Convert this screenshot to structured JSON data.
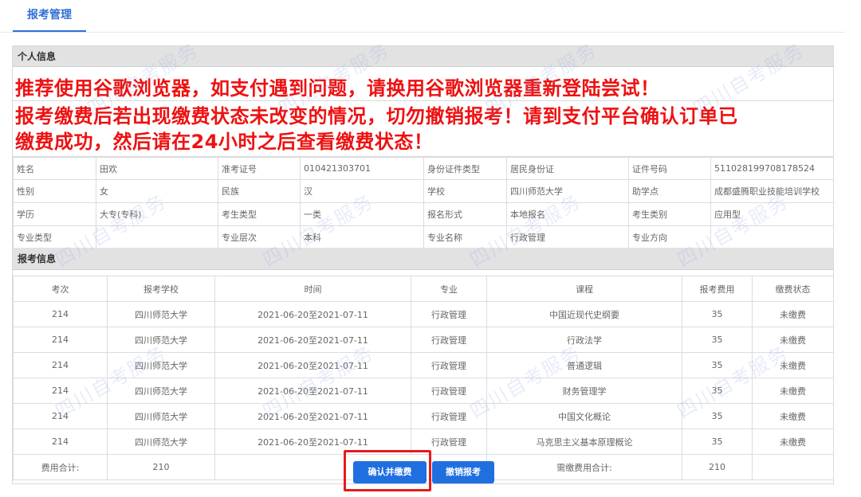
{
  "tab": {
    "label": "报考管理"
  },
  "personal_section": {
    "title": "个人信息"
  },
  "notice": {
    "line1": "推荐使用谷歌浏览器，如支付遇到问题，请换用谷歌浏览器重新登陆尝试！",
    "line2": "报考缴费后若出现缴费状态未改变的情况，切勿撤销报考！请到支付平台确认订单已",
    "line3": "缴费成功，然后请在24小时之后查看缴费状态！"
  },
  "info_rows": [
    [
      "姓名",
      "田欢",
      "准考证号",
      "010421303701",
      "身份证件类型",
      "居民身份证",
      "证件号码",
      "511028199708178524"
    ],
    [
      "性别",
      "女",
      "民族",
      "汉",
      "学校",
      "四川师范大学",
      "助学点",
      "成都盛腾职业技能培训学校"
    ],
    [
      "学历",
      "大专(专科)",
      "考生类型",
      "一类",
      "报名形式",
      "本地报名",
      "考生类别",
      "应用型"
    ],
    [
      "专业类型",
      "",
      "专业层次",
      "本科",
      "专业名称",
      "行政管理",
      "专业方向",
      ""
    ]
  ],
  "exam_section": {
    "title": "报考信息"
  },
  "exam_table": {
    "headers": [
      "考次",
      "报考学校",
      "时间",
      "专业",
      "课程",
      "报考费用",
      "缴费状态"
    ],
    "rows": [
      [
        "214",
        "四川师范大学",
        "2021-06-20至2021-07-11",
        "行政管理",
        "中国近现代史纲要",
        "35",
        "未缴费"
      ],
      [
        "214",
        "四川师范大学",
        "2021-06-20至2021-07-11",
        "行政管理",
        "行政法学",
        "35",
        "未缴费"
      ],
      [
        "214",
        "四川师范大学",
        "2021-06-20至2021-07-11",
        "行政管理",
        "普通逻辑",
        "35",
        "未缴费"
      ],
      [
        "214",
        "四川师范大学",
        "2021-06-20至2021-07-11",
        "行政管理",
        "财务管理学",
        "35",
        "未缴费"
      ],
      [
        "214",
        "四川师范大学",
        "2021-06-20至2021-07-11",
        "行政管理",
        "中国文化概论",
        "35",
        "未缴费"
      ],
      [
        "214",
        "四川师范大学",
        "2021-06-20至2021-07-11",
        "行政管理",
        "马克思主义基本原理概论",
        "35",
        "未缴费"
      ]
    ],
    "total": {
      "label": "费用合计:",
      "value": "210",
      "due_label": "需缴费用合计:",
      "due_value": "210"
    }
  },
  "buttons": {
    "confirm_pay": "确认并缴费",
    "cancel_registration": "撤销报考"
  },
  "watermark": {
    "text": "四川自考服务"
  },
  "colors": {
    "accent": "#1f6fe0",
    "warning": "#ee1111",
    "highlight": "#e8191c"
  }
}
